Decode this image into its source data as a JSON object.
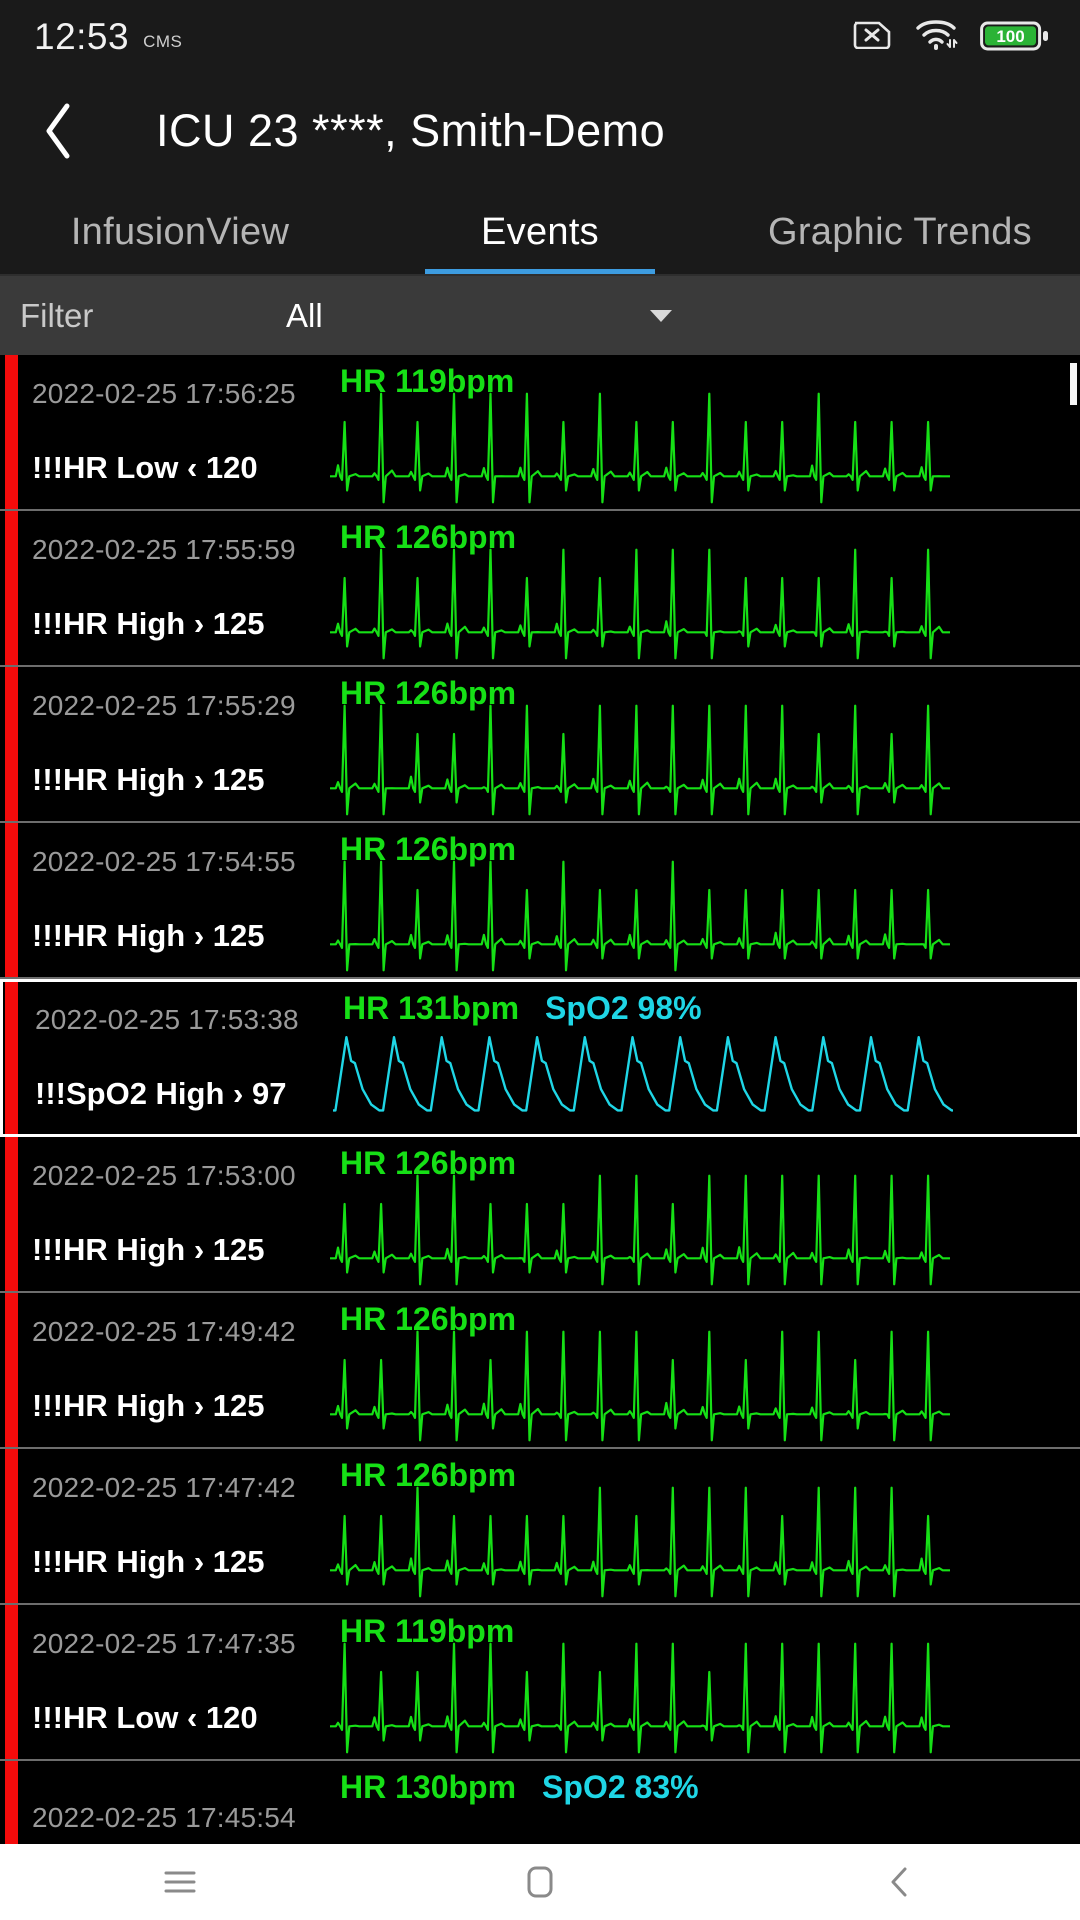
{
  "colors": {
    "accent": "#3d9ce0",
    "alarm_bar": "#f40b0b",
    "hr_green": "#16e016",
    "spo2_cyan": "#1fd6e6",
    "battery_green": "#2bb336",
    "list_bg": "#000000",
    "chrome_bg": "#1a1a1a",
    "filter_bg": "#3a3a3a"
  },
  "statusbar": {
    "clock": "12:53",
    "carrier": "CMS",
    "battery_level": "100",
    "icons": {
      "sim": "sim-card-off-icon",
      "wifi": "wifi-icon",
      "battery": "battery-full-icon"
    }
  },
  "header": {
    "back_label": "‹",
    "title": "ICU 23 ****, Smith-Demo"
  },
  "tabs": [
    {
      "label": "InfusionView",
      "active": false
    },
    {
      "label": "Events",
      "active": true
    },
    {
      "label": "Graphic Trends",
      "active": false
    }
  ],
  "filter": {
    "label": "Filter",
    "value": "All",
    "placeholder": "All",
    "options": [
      "All"
    ]
  },
  "events": [
    {
      "timestamp": "2022-02-25 17:56:25",
      "alarm": "!!!HR Low ‹ 120",
      "hr": "HR 119bpm",
      "spo2": "",
      "wave": "ecg",
      "selected": false
    },
    {
      "timestamp": "2022-02-25 17:55:59",
      "alarm": "!!!HR High › 125",
      "hr": "HR 126bpm",
      "spo2": "",
      "wave": "ecg",
      "selected": false
    },
    {
      "timestamp": "2022-02-25 17:55:29",
      "alarm": "!!!HR High › 125",
      "hr": "HR 126bpm",
      "spo2": "",
      "wave": "ecg",
      "selected": false
    },
    {
      "timestamp": "2022-02-25 17:54:55",
      "alarm": "!!!HR High › 125",
      "hr": "HR 126bpm",
      "spo2": "",
      "wave": "ecg",
      "selected": false
    },
    {
      "timestamp": "2022-02-25 17:53:38",
      "alarm": "!!!SpO2 High › 97",
      "hr": "HR 131bpm",
      "spo2": "SpO2 98%",
      "wave": "pleth",
      "selected": true
    },
    {
      "timestamp": "2022-02-25 17:53:00",
      "alarm": "!!!HR High › 125",
      "hr": "HR 126bpm",
      "spo2": "",
      "wave": "ecg",
      "selected": false
    },
    {
      "timestamp": "2022-02-25 17:49:42",
      "alarm": "!!!HR High › 125",
      "hr": "HR 126bpm",
      "spo2": "",
      "wave": "ecg",
      "selected": false
    },
    {
      "timestamp": "2022-02-25 17:47:42",
      "alarm": "!!!HR High › 125",
      "hr": "HR 126bpm",
      "spo2": "",
      "wave": "ecg",
      "selected": false
    },
    {
      "timestamp": "2022-02-25 17:47:35",
      "alarm": "!!!HR Low ‹ 120",
      "hr": "HR 119bpm",
      "spo2": "",
      "wave": "ecg",
      "selected": false
    },
    {
      "timestamp": "2022-02-25 17:45:54",
      "alarm": "",
      "hr": "HR 130bpm",
      "spo2": "SpO2 83%",
      "wave": "none",
      "selected": false
    }
  ],
  "navbar": {
    "recents": "recents-icon",
    "home": "home-icon",
    "back": "back-icon"
  }
}
